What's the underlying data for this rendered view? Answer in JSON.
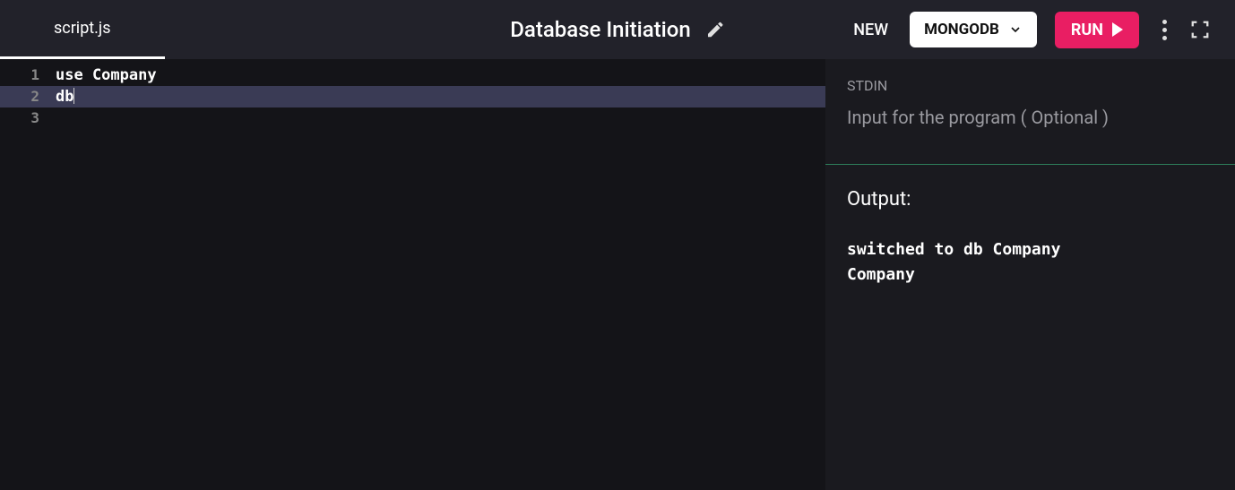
{
  "header": {
    "tab_label": "script.js",
    "title": "Database Initiation",
    "new_label": "NEW",
    "language_label": "MONGODB",
    "run_label": "RUN"
  },
  "editor": {
    "lines": [
      {
        "num": "1",
        "text": "use Company"
      },
      {
        "num": "2",
        "text": "db"
      },
      {
        "num": "3",
        "text": ""
      }
    ],
    "active_line_index": 1
  },
  "io": {
    "stdin_label": "STDIN",
    "stdin_placeholder": "Input for the program ( Optional )",
    "output_label": "Output:",
    "output_text": "switched to db Company\nCompany"
  }
}
